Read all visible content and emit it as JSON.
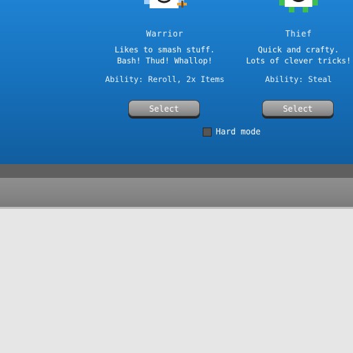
{
  "characters": [
    {
      "name": "Warrior",
      "desc_line1": "Likes to smash stuff.",
      "desc_line2": "Bash! Thud! Whallop!",
      "ability": "Ability: Reroll, 2x Items",
      "select_label": "Select",
      "sprite_icon": "warrior-sprite-icon",
      "accent_color": "#e8a13a"
    },
    {
      "name": "Thief",
      "desc_line1": "Quick and crafty.",
      "desc_line2": "Lots of clever tricks!",
      "ability": "Ability: Steal",
      "select_label": "Select",
      "sprite_icon": "thief-sprite-icon",
      "accent_color": "#3fbf4f"
    }
  ],
  "options": {
    "hard_mode_label": "Hard mode",
    "hard_mode_checked": false
  },
  "colors": {
    "panel_blue": "#1874c0",
    "shelf_gray": "#858585",
    "background": "#e6e6e6"
  }
}
